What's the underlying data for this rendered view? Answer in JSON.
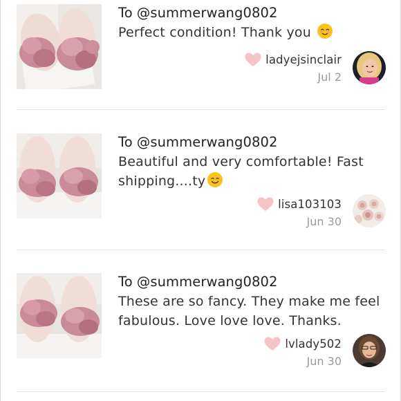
{
  "reviews": [
    {
      "to_prefix": "To",
      "recipient": "@summerwang0802",
      "comment": "Perfect condition! Thank you",
      "emoji": "smiling-face-icon",
      "author": "ladyejsinclair",
      "date": "Jul 2"
    },
    {
      "to_prefix": "To",
      "recipient": "@summerwang0802",
      "comment": "Beautiful and very comfortable! Fast shipping....ty",
      "emoji": "smiling-face-icon",
      "author": "lisa103103",
      "date": "Jun 30"
    },
    {
      "to_prefix": "To",
      "recipient": "@summerwang0802",
      "comment": "These are so fancy. They make me feel fabulous. Love love love. Thanks.",
      "author": "lvlady502",
      "date": "Jun 30"
    }
  ],
  "colors": {
    "heart": "#f6c3c8",
    "date": "#9a9a9a",
    "divider": "#e2e2e2",
    "fur": "#c98a99"
  }
}
